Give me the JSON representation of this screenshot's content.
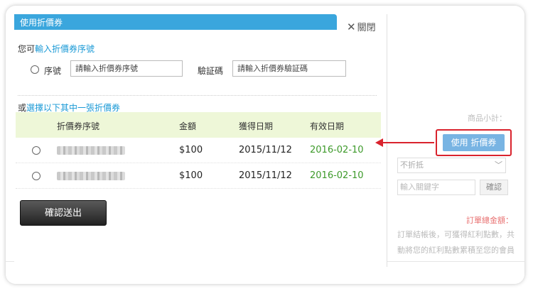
{
  "dialog": {
    "title": "使用折價券",
    "close_label": "關閉",
    "option1_prefix": "您可",
    "option1_link": "輸入折價券序號",
    "serial_label": "序號",
    "serial_placeholder": "請輸入折價券序號",
    "verify_label": "驗証碼",
    "verify_placeholder": "請輸入折價券驗証碼",
    "option2_prefix": "或",
    "option2_link": "選擇以下其中一張折價券",
    "table": {
      "headers": [
        "折價券序號",
        "金額",
        "獲得日期",
        "有效日期"
      ],
      "rows": [
        {
          "amount": "$100",
          "obtained": "2015/11/12",
          "valid": "2016-02-10"
        },
        {
          "amount": "$100",
          "obtained": "2015/11/12",
          "valid": "2016-02-10"
        }
      ]
    },
    "submit_label": "確認送出"
  },
  "background": {
    "subtotal_label": "商品小計：",
    "coupon_button": "使用 折價券",
    "discount_select": "不折抵",
    "keyword_placeholder": "輸入關鍵字",
    "confirm_label": "確認",
    "total_label": "訂單總金額：",
    "note_line1": "訂單結帳後，可獲得紅利點數，共",
    "note_line2": "動將您的紅利點數累積至您的會員"
  },
  "colors": {
    "header_blue": "#3aa6dd",
    "link_blue": "#1b9ad6",
    "valid_green": "#3d9a2a",
    "highlight_red": "#d9232d",
    "table_head_bg": "#eef7d8"
  }
}
